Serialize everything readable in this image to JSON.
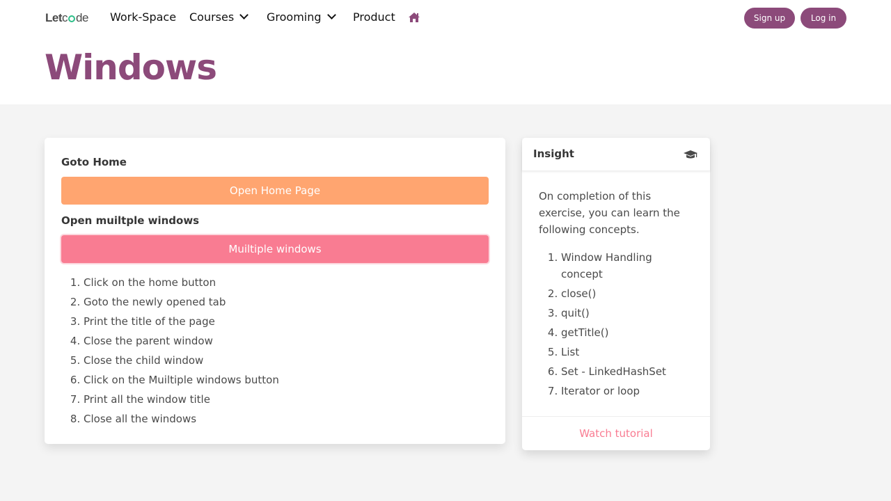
{
  "nav": {
    "logo_let": "Let",
    "logo_c": "c",
    "logo_de": "de",
    "items": [
      "Work-Space",
      "Courses",
      "Grooming",
      "Product"
    ],
    "home_icon": "home-icon",
    "signup": "Sign up",
    "login": "Log in"
  },
  "page": {
    "title": "Windows"
  },
  "exercise": {
    "goto_home_label": "Goto Home",
    "open_home_button": "Open Home Page",
    "multi_label": "Open muiltple windows",
    "multi_button": "Muiltiple windows",
    "steps": [
      "Click on the home button",
      "Goto the newly opened tab",
      "Print the title of the page",
      "Close the parent window",
      "Close the child window",
      "Click on the Muiltiple windows button",
      "Print all the window title",
      "Close all the windows"
    ]
  },
  "insight": {
    "title": "Insight",
    "icon": "graduation-cap-icon",
    "intro": "On completion of this exercise, you can learn the following concepts.",
    "concepts": [
      "Window Handling concept",
      "close()",
      "quit()",
      "getTitle()",
      "List",
      "Set - LinkedHashSet",
      "Iterator or loop"
    ],
    "watch": "Watch tutorial"
  },
  "colors": {
    "brand": "#8c4a7a",
    "orange_button": "#ffa570",
    "pink_button": "#f97c92",
    "logo_accent": "#2dbe88"
  }
}
